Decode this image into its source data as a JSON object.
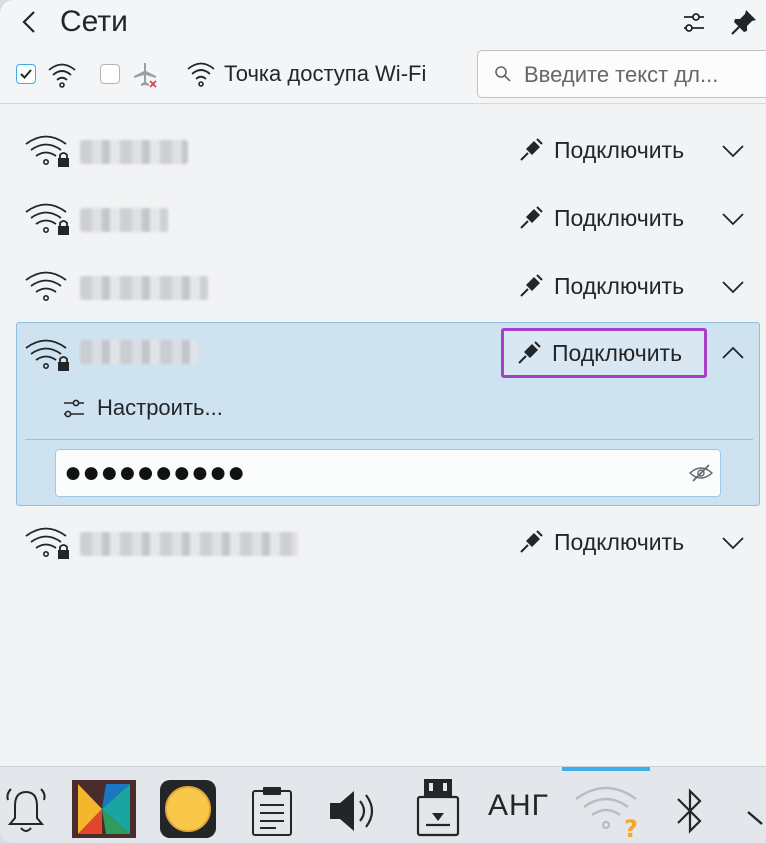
{
  "header": {
    "title": "Сети",
    "hotspot_label": "Точка доступа Wi-Fi",
    "search_placeholder": "Введите текст дл..."
  },
  "filters": {
    "wifi_enabled": true,
    "airplane_mode": false
  },
  "networks": [
    {
      "connect_label": "Подключить",
      "secured": true,
      "expanded": false
    },
    {
      "connect_label": "Подключить",
      "secured": true,
      "expanded": false
    },
    {
      "connect_label": "Подключить",
      "secured": false,
      "expanded": false
    },
    {
      "connect_label": "Подключить",
      "secured": true,
      "expanded": true,
      "configure_label": "Настроить...",
      "password_mask": "●●●●●●●●●●"
    },
    {
      "connect_label": "Подключить",
      "secured": true,
      "expanded": false
    }
  ],
  "taskbar": {
    "keyboard_layout": "АНГ",
    "items": [
      "bell-icon",
      "app-launcher-icon",
      "night-light-icon",
      "clipboard-icon",
      "volume-icon",
      "usb-drive-icon",
      "keyboard-layout",
      "network-icon",
      "bluetooth-icon",
      "expand-tray-icon"
    ]
  },
  "colors": {
    "accent": "#3daee9",
    "highlight_border": "#a540c8",
    "expanded_bg": "#cfe2f0"
  }
}
